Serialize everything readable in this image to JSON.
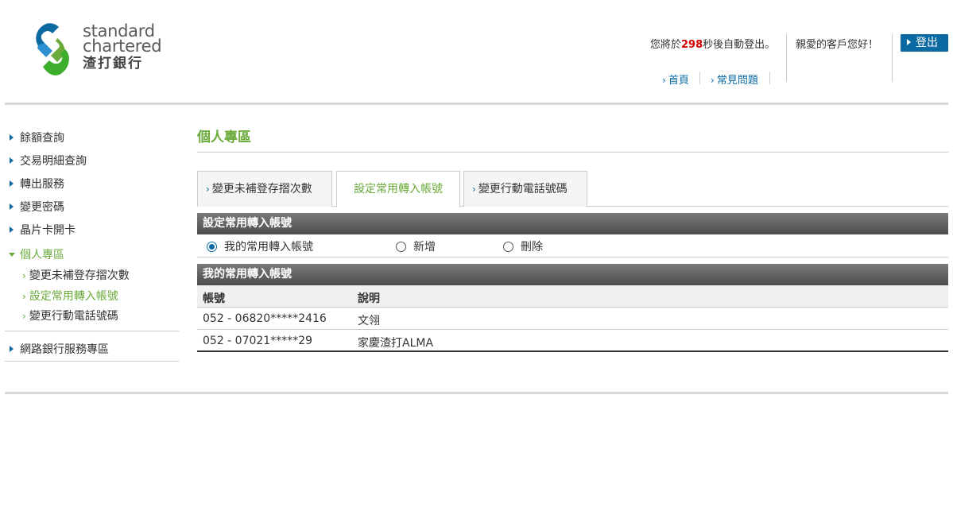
{
  "brand": {
    "line1": "standard",
    "line2": "chartered",
    "line3": "渣打銀行",
    "colors": {
      "green": "#6aaa3a",
      "blue": "#0a6aa1"
    }
  },
  "header": {
    "logout_prefix": "您將於",
    "logout_count": "298",
    "logout_suffix": "秒後自動登出。",
    "greeting": "親愛的客戶您好！",
    "logout_button": "登出",
    "links": {
      "home": "首頁",
      "faq": "常見問題"
    }
  },
  "sidebar": {
    "items": [
      {
        "label": "餘額查詢"
      },
      {
        "label": "交易明細查詢"
      },
      {
        "label": "轉出服務"
      },
      {
        "label": "變更密碼"
      },
      {
        "label": "晶片卡開卡"
      },
      {
        "label": "個人專區"
      }
    ],
    "sub_items": [
      {
        "label": "變更未補登存摺次數"
      },
      {
        "label": "設定常用轉入帳號"
      },
      {
        "label": "變更行動電話號碼"
      }
    ],
    "extra": {
      "label": "網路銀行服務專區"
    }
  },
  "main": {
    "title": "個人專區",
    "tabs": [
      {
        "label": "變更未補登存摺次數"
      },
      {
        "label": "設定常用轉入帳號"
      },
      {
        "label": "變更行動電話號碼"
      }
    ],
    "section_title": "設定常用轉入帳號",
    "radios": [
      {
        "label": "我的常用轉入帳號",
        "checked": true
      },
      {
        "label": "新增",
        "checked": false
      },
      {
        "label": "刪除",
        "checked": false
      }
    ],
    "list_title": "我的常用轉入帳號",
    "table": {
      "headers": [
        "帳號",
        "說明"
      ],
      "rows": [
        [
          "052 - 06820*****2416",
          "文翎"
        ],
        [
          "052 - 07021*****29",
          "家慶渣打ALMA"
        ]
      ]
    }
  }
}
